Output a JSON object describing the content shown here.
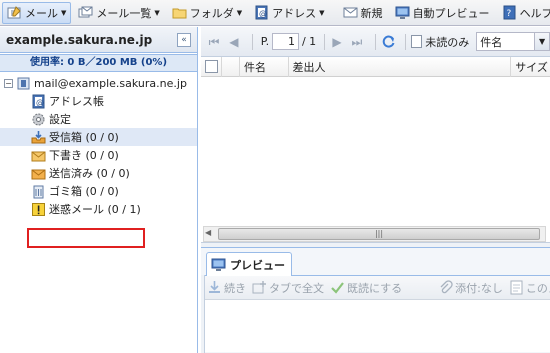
{
  "toolbar": {
    "mail": "メール",
    "mail_list": "メール一覧",
    "folder": "フォルダ",
    "address": "アドレス",
    "new": "新規",
    "auto_preview": "自動プレビュー",
    "help": "ヘルプ"
  },
  "account": {
    "title": "example.sakura.ne.jp",
    "collapse_glyph": "«",
    "usage": "使用率: 0 B／200 MB (0%)"
  },
  "tree": {
    "root": "mail@example.sakura.ne.jp",
    "items": [
      {
        "label": "アドレス帳",
        "icon": "address-book-icon"
      },
      {
        "label": "設定",
        "icon": "gear-icon"
      },
      {
        "label": "受信箱 (0 / 0)",
        "icon": "inbox-icon"
      },
      {
        "label": "下書き (0 / 0)",
        "icon": "drafts-icon"
      },
      {
        "label": "送信済み (0 / 0)",
        "icon": "sent-icon"
      },
      {
        "label": "ゴミ箱 (0 / 0)",
        "icon": "trash-icon"
      },
      {
        "label": "迷惑メール (0 / 1)",
        "icon": "warning-icon"
      }
    ]
  },
  "pager": {
    "page_prefix": "P.",
    "page_value": "1",
    "page_total": "/ 1",
    "unread_only": "未読のみ",
    "search_field": "件名"
  },
  "grid": {
    "columns": [
      "件名",
      "差出人",
      "サイズ"
    ]
  },
  "preview": {
    "tab": "プレビュー",
    "tools": [
      "続き",
      "タブで全文",
      "既読にする",
      "添付:なし",
      "このメ"
    ]
  },
  "colors": {
    "accent": "#99bbe8",
    "highlight_box": "#e02020",
    "selected_row": "#dfe8f6"
  }
}
